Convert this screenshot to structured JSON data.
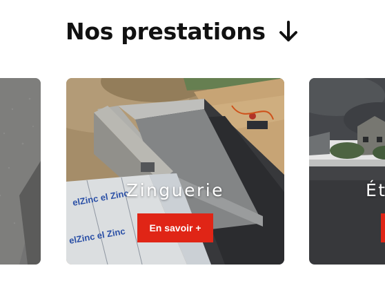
{
  "section": {
    "title": "Nos prestations",
    "arrow_icon": "arrow-down-icon"
  },
  "cards": [
    {
      "title": "",
      "button_label": ""
    },
    {
      "title": "Zinguerie",
      "button_label": "En savoir +"
    },
    {
      "title": "Ét",
      "button_label": ""
    }
  ],
  "colors": {
    "accent": "#e02516",
    "heading": "#111111"
  }
}
